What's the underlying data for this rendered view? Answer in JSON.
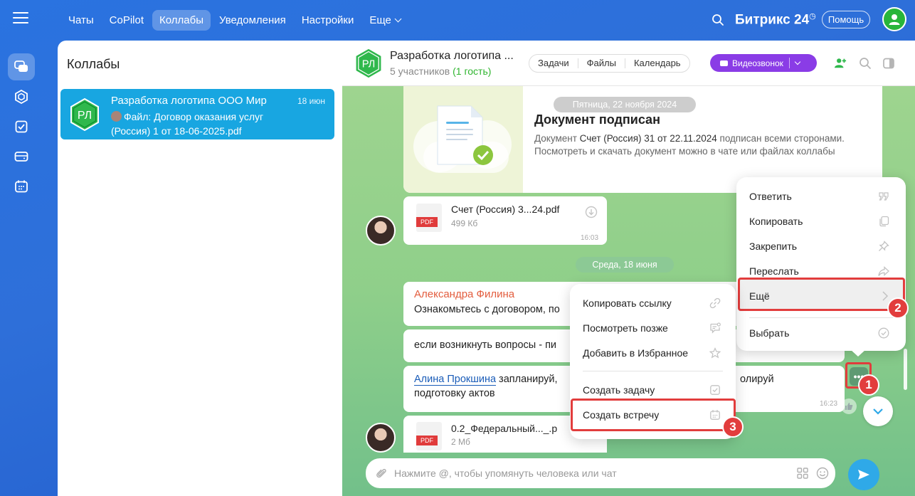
{
  "top_nav": {
    "items": [
      {
        "label": "Чаты",
        "active": false
      },
      {
        "label": "CoPilot",
        "active": false
      },
      {
        "label": "Коллабы",
        "active": true
      },
      {
        "label": "Уведомления",
        "active": false
      },
      {
        "label": "Настройки",
        "active": false
      },
      {
        "label": "Еще",
        "active": false
      }
    ],
    "brand": "Битрикс 24",
    "help_label": "Помощь"
  },
  "list_panel": {
    "title": "Коллабы",
    "items": [
      {
        "initials": "РЛ",
        "title": "Разработка логотипа ООО Мир",
        "date": "18 июн",
        "subtitle": "Файл: Договор оказания услуг (Россия) 1 от 18-06-2025.pdf"
      }
    ]
  },
  "chat_header": {
    "initials": "РЛ",
    "title": "Разработка логотипа ...",
    "members": "5 участников",
    "guests": "(1 гость)",
    "tabs": [
      "Задачи",
      "Файлы",
      "Календарь"
    ],
    "video_label": "Видеозвонок"
  },
  "messages": {
    "date_1": "Пятница, 22 ноября 2024",
    "doc_title": "Документ подписан",
    "doc_text_1": "Документ ",
    "doc_text_name": "Счет (Россия) 31 от 22.11.2024",
    "doc_text_2": " подписан всеми сторонами. Посмотреть и скачать документ можно в чате или файлах коллабы",
    "file_1": {
      "name": "Счет (Россия) 3...24.pdf",
      "size": "499 Кб",
      "time": "16:03",
      "tag": "PDF"
    },
    "date_2": "Среда, 18 июня",
    "author_1": "Александра Филина",
    "text_1": "Ознакомьтесь с договором, по",
    "text_2": "если возникнуть вопросы - пи",
    "mention": "Алина Прокшина",
    "text_3a": " запланируй,",
    "text_3b": "олируй",
    "text_3c": "подготовку актов",
    "time_3": "16:23",
    "file_2": {
      "name": "0.2_Федеральный..._.р",
      "size": "2 Мб",
      "tag": "PDF"
    }
  },
  "input": {
    "placeholder": "Нажмите @, чтобы упомянуть человека или чат"
  },
  "main_menu": {
    "items": [
      "Ответить",
      "Копировать",
      "Закрепить",
      "Переслать",
      "Ещё",
      "Выбрать"
    ]
  },
  "sub_menu": {
    "items": [
      "Копировать ссылку",
      "Посмотреть позже",
      "Добавить в Избранное",
      "Создать задачу",
      "Создать встречу"
    ]
  },
  "badges": [
    "1",
    "2",
    "3"
  ],
  "colors": {
    "accent": "#18a6e1",
    "video": "#8a3ce6",
    "highlight": "#e23d3d",
    "author": "#e35d3e"
  }
}
